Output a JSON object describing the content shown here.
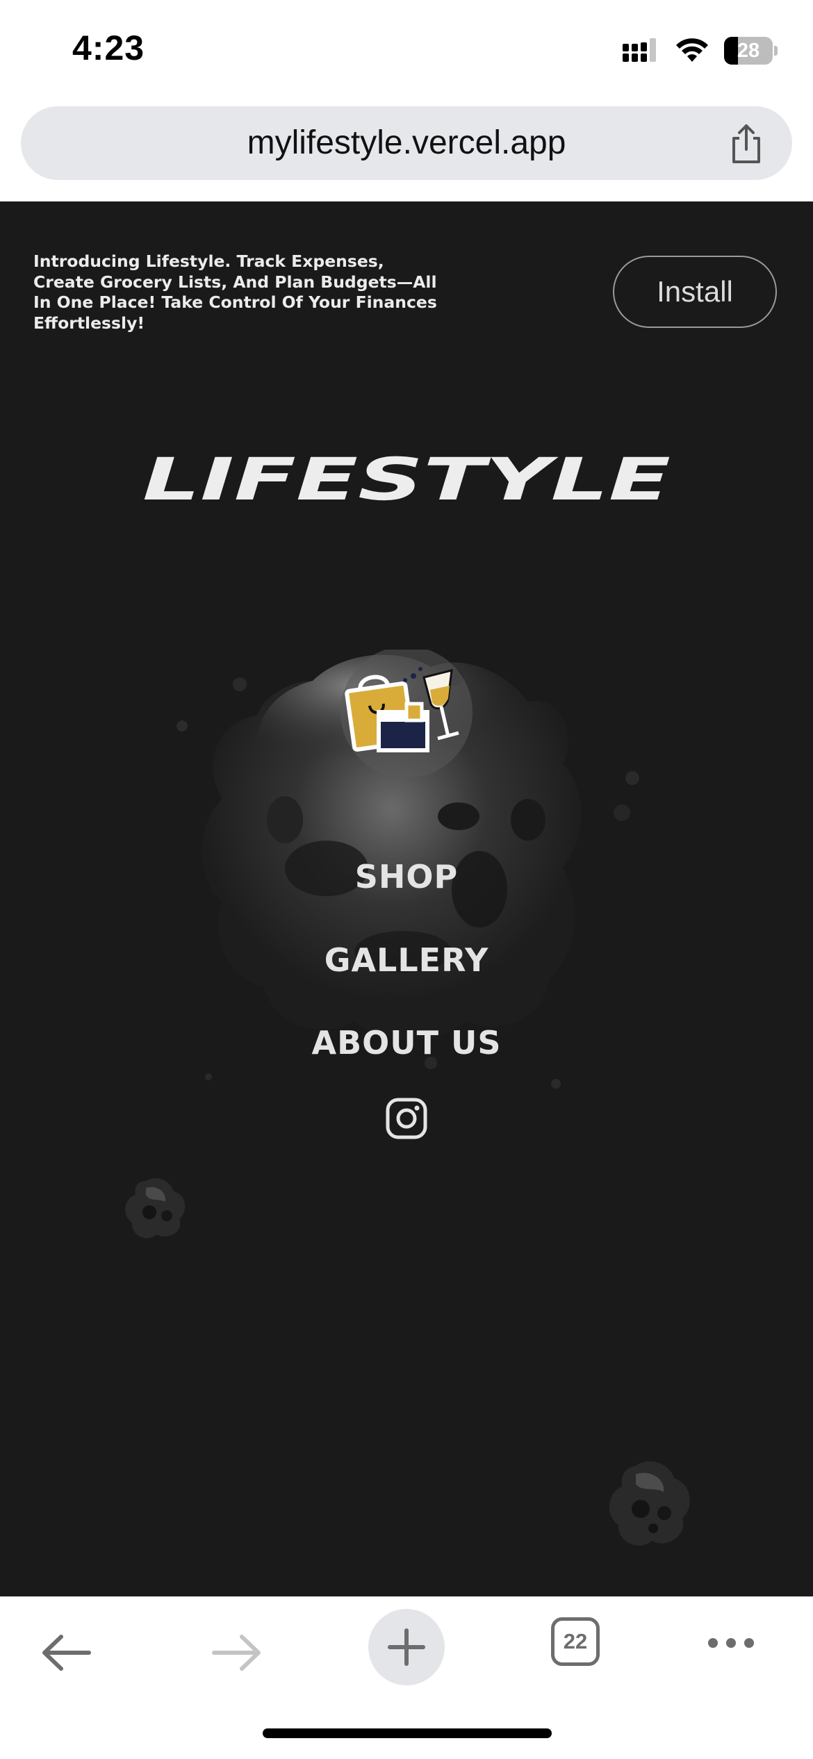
{
  "status_bar": {
    "time": "4:23",
    "battery_level": "28",
    "icons": [
      "cellular-signal-icon",
      "wifi-icon",
      "battery-icon"
    ]
  },
  "browser": {
    "url": "mylifestyle.vercel.app",
    "share_icon": "share-icon"
  },
  "page": {
    "install_banner": {
      "text": "Introducing Lifestyle. Track Expenses, Create Grocery Lists, And Plan Budgets—All In One Place! Take Control Of Your Finances Effortlessly!",
      "button_label": "Install"
    },
    "logo_text": "LIFESTYLE",
    "nav": {
      "shop": "SHOP",
      "gallery": "GALLERY",
      "about": "ABOUT US"
    },
    "social_icon": "instagram-icon",
    "colors": {
      "background": "#1a1a1b",
      "text": "#e4e4e4",
      "accent_gold": "#d9ac3a",
      "accent_navy": "#1b2447"
    }
  },
  "toolbar": {
    "tab_count": "22",
    "icons": [
      "back-arrow-icon",
      "forward-arrow-icon",
      "plus-icon",
      "tabs-icon",
      "more-icon"
    ]
  }
}
